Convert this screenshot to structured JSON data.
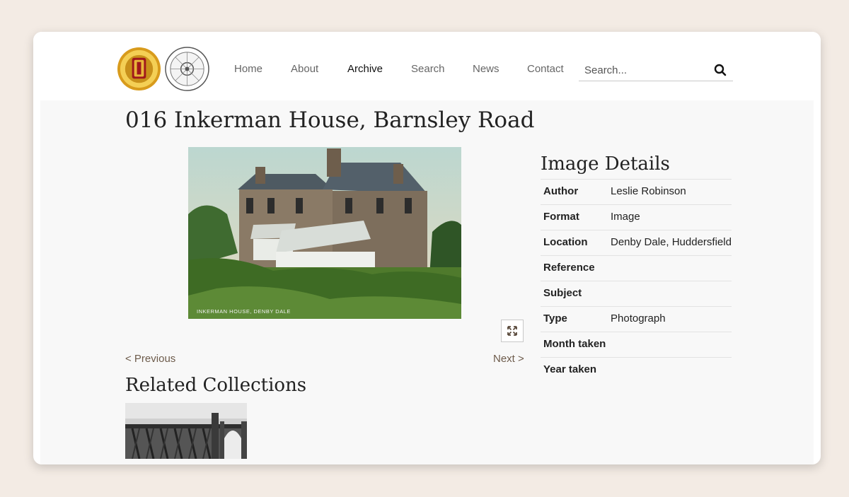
{
  "header": {
    "nav": [
      {
        "label": "Home",
        "active": false
      },
      {
        "label": "About",
        "active": false
      },
      {
        "label": "Archive",
        "active": true
      },
      {
        "label": "Search",
        "active": false
      },
      {
        "label": "News",
        "active": false
      },
      {
        "label": "Contact",
        "active": false
      }
    ],
    "search": {
      "placeholder": "Search..."
    },
    "logos": [
      {
        "icon": "parish-council-logo",
        "color": "#e2a21e"
      },
      {
        "icon": "society-logo",
        "color": "#666666"
      }
    ]
  },
  "main": {
    "title": "016 Inkerman House, Barnsley Road",
    "image": {
      "caption_in_photo": "INKERMAN HOUSE, DENBY DALE",
      "icon": "expand-icon"
    },
    "prev_label": "< Previous",
    "next_label": "Next >",
    "related": {
      "title": "Related Collections"
    }
  },
  "details": {
    "title": "Image Details",
    "rows": [
      {
        "label": "Author",
        "value": "Leslie Robinson"
      },
      {
        "label": "Format",
        "value": "Image"
      },
      {
        "label": "Location",
        "value": "Denby Dale, Huddersfield"
      },
      {
        "label": "Reference",
        "value": ""
      },
      {
        "label": "Subject",
        "value": ""
      },
      {
        "label": "Type",
        "value": "Photograph"
      },
      {
        "label": "Month taken",
        "value": ""
      },
      {
        "label": "Year taken",
        "value": ""
      }
    ]
  },
  "colors": {
    "page_bg": "#f3ebe4",
    "link": "#6d5b4b",
    "content_bg": "#f8f8f8"
  }
}
